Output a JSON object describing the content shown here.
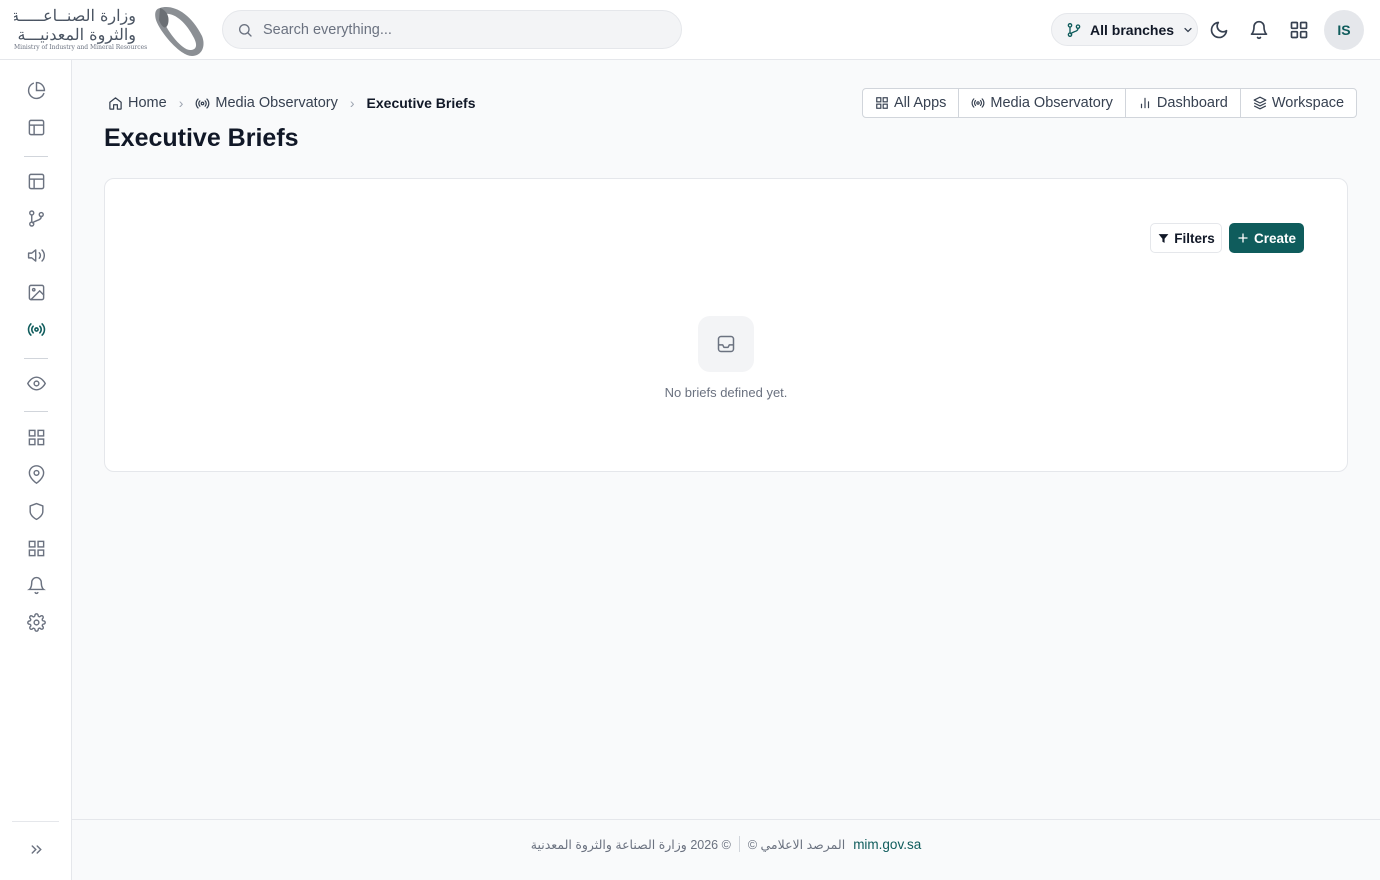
{
  "header": {
    "logo": {
      "line1": "وزارة الصنــاعـــــة",
      "line2": "والثروة المعدنيـــة",
      "english": "Ministry of Industry and Mineral Resources"
    },
    "search_placeholder": "Search everything...",
    "branch_label": "All branches",
    "user_initials": "IS"
  },
  "breadcrumb": {
    "home": "Home",
    "parent": "Media Observatory",
    "current": "Executive Briefs"
  },
  "page": {
    "title": "Executive Briefs"
  },
  "quick_links": {
    "all_apps": "All Apps",
    "media_observatory": "Media Observatory",
    "dashboard": "Dashboard",
    "workspace": "Workspace"
  },
  "card": {
    "filters_label": "Filters",
    "create_label": "Create",
    "empty_message": "No briefs defined yet."
  },
  "footer": {
    "copyright": "© 2026 وزارة الصناعة والثروة المعدنية",
    "observatory": "المرصد الاعلامي ©",
    "link": "mim.gov.sa"
  },
  "colors": {
    "accent": "#0f5c5c",
    "border": "#e5e7eb",
    "text": "#111827",
    "muted": "#6b7280"
  }
}
